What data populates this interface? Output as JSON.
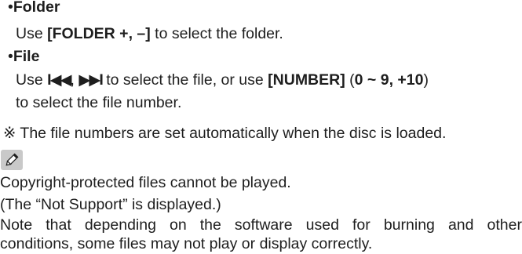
{
  "items": {
    "folder": {
      "bullet": "•",
      "label": "Folder",
      "desc_pre": "Use ",
      "desc_key": "[FOLDER +, –]",
      "desc_post": " to select the folder."
    },
    "file": {
      "bullet": "•",
      "label": "File",
      "desc_pre": "Use ",
      "skip_back_key": "I◀◀",
      "comma": ", ",
      "skip_fwd_key": "▶▶I",
      "desc_mid": " to select the file, or use ",
      "number_key": "[NUMBER]",
      "paren_open": " (",
      "number_range": "0 ~ 9, +10",
      "paren_close": ")",
      "desc_line2": "to select the file number."
    }
  },
  "note_mark": {
    "symbol": "※",
    "text": " The file numbers are set automatically when the disc is loaded."
  },
  "memo": {
    "icon": "pencil-icon",
    "line1": "Copyright-protected files cannot be played.",
    "line2": "(The “Not Support” is  displayed.)",
    "line3": "Note that depending on the software used for burning and other",
    "line4": "conditions, some files may not play or display correctly."
  },
  "colors": {
    "text": "#1e1e1e",
    "icon_bg": "#c9c9c9"
  }
}
